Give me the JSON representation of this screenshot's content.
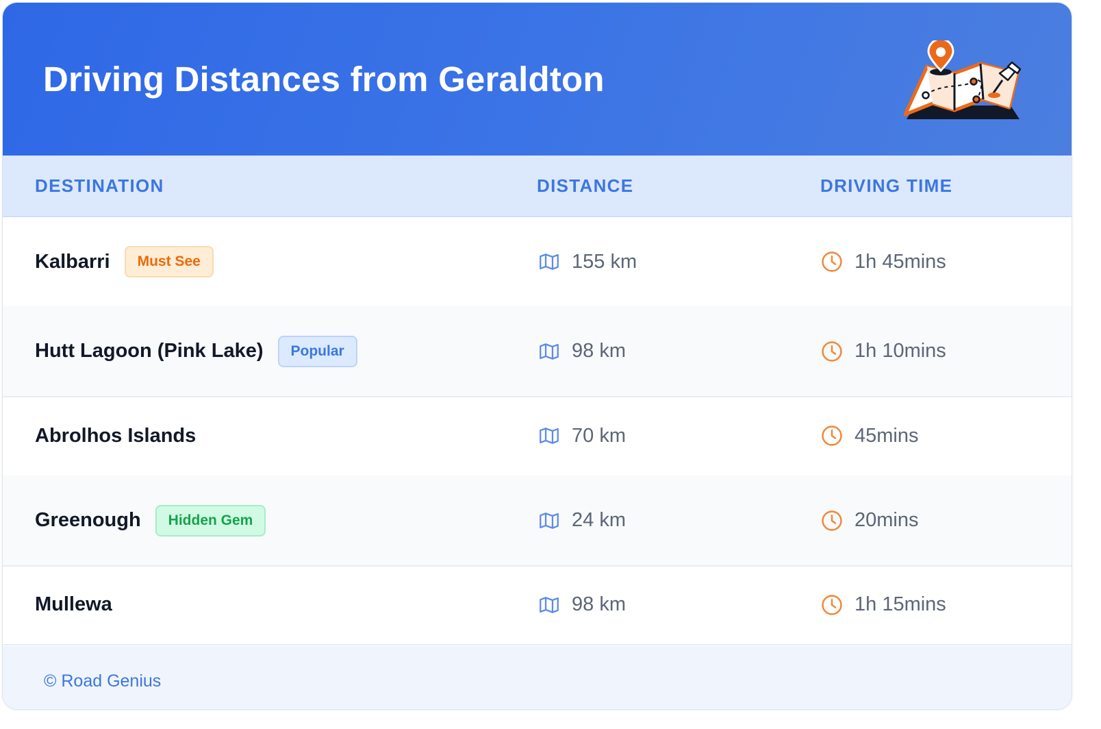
{
  "header": {
    "title": "Driving Distances from Geraldton"
  },
  "table": {
    "columns": [
      "DESTINATION",
      "DISTANCE",
      "DRIVING TIME"
    ],
    "rows": [
      {
        "destination": "Kalbarri",
        "badge": "Must See",
        "badge_style": "orange",
        "distance": "155 km",
        "time": "1h 45mins"
      },
      {
        "destination": "Hutt Lagoon (Pink Lake)",
        "badge": "Popular",
        "badge_style": "blue",
        "distance": "98 km",
        "time": "1h 10mins"
      },
      {
        "destination": "Abrolhos Islands",
        "badge": null,
        "badge_style": null,
        "distance": "70 km",
        "time": "45mins"
      },
      {
        "destination": "Greenough",
        "badge": "Hidden Gem",
        "badge_style": "green",
        "distance": "24 km",
        "time": "20mins"
      },
      {
        "destination": "Mullewa",
        "badge": null,
        "badge_style": null,
        "distance": "98 km",
        "time": "1h 15mins"
      }
    ]
  },
  "footer": {
    "credit": "© Road Genius"
  },
  "icons": {
    "distance": "map-icon",
    "time": "clock-icon",
    "header_illustration": "map-pin-illustration"
  },
  "colors": {
    "header_gradient_start": "#2f68e6",
    "header_gradient_end": "#4b7edf",
    "accent_blue": "#3c76e0",
    "clock_orange": "#f08a3c",
    "badge_orange_text": "#ea6a0c",
    "badge_orange_bg": "#ffedd5",
    "badge_blue_text": "#3c76e0",
    "badge_blue_bg": "#dbeafe",
    "badge_green_text": "#16a34a",
    "badge_green_bg": "#d1fae5"
  }
}
